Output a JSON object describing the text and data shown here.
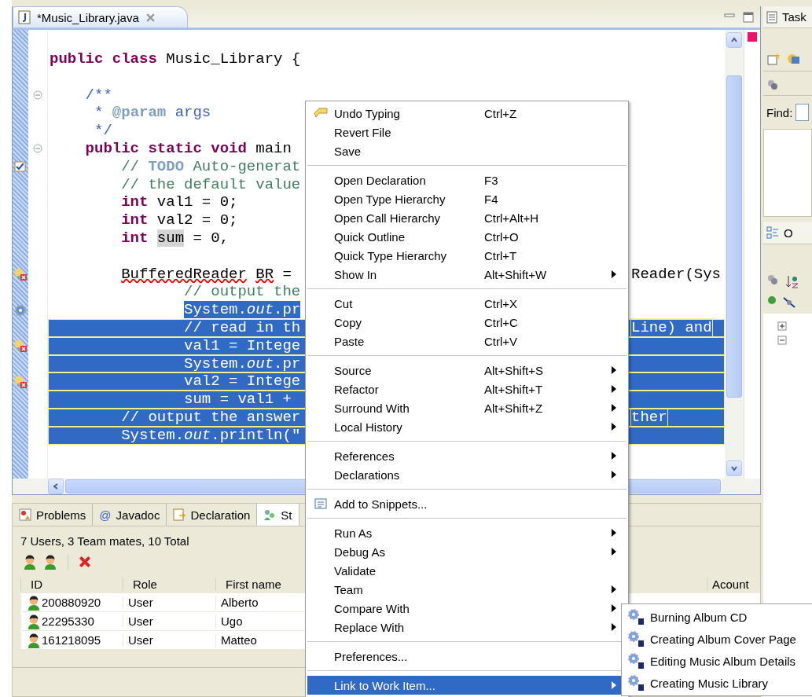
{
  "editor": {
    "tab": {
      "label": "*Music_Library.java",
      "selected": true
    },
    "lines": [
      {
        "segments": [
          {
            "t": "public class",
            "kind": "kw",
            "selected": false
          },
          {
            "t": " Music_Library {",
            "kind": "plain",
            "selected": false
          }
        ],
        "selected": false
      },
      {
        "selected": false
      },
      {
        "segments": [
          {
            "t": "    /**",
            "kind": "doc",
            "selected": false
          }
        ],
        "selected": false
      },
      {
        "segments": [
          {
            "t": "     *",
            "kind": "doc",
            "selected": false
          },
          {
            "t": " @param",
            "kind": "tag",
            "selected": false
          },
          {
            "t": " args",
            "kind": "doc",
            "selected": false
          }
        ],
        "selected": false
      },
      {
        "segments": [
          {
            "t": "     */",
            "kind": "doc",
            "selected": false
          }
        ],
        "selected": false
      },
      {
        "segments": [
          {
            "t": "    public static void",
            "kind": "kw",
            "selected": false
          },
          {
            "t": " main",
            "kind": "plain",
            "selected": false
          }
        ],
        "selected": false
      },
      {
        "segments": [
          {
            "t": "        //",
            "kind": "comment",
            "selected": false
          },
          {
            "t": " TODO",
            "kind": "tag",
            "selected": false
          },
          {
            "t": " Auto-generat",
            "kind": "comment",
            "selected": false
          }
        ],
        "selected": false
      },
      {
        "segments": [
          {
            "t": "        // the default value",
            "kind": "comment",
            "selected": false
          }
        ],
        "selected": false
      },
      {
        "segments": [
          {
            "t": "        int",
            "kind": "kw",
            "selected": false
          },
          {
            "t": " val1 = 0;",
            "kind": "plain",
            "selected": false
          }
        ],
        "selected": false
      },
      {
        "segments": [
          {
            "t": "        int",
            "kind": "kw",
            "selected": false
          },
          {
            "t": " val2 = 0;",
            "kind": "plain",
            "selected": false
          }
        ],
        "selected": false
      },
      {
        "segments": [
          {
            "t": "        int",
            "kind": "kw",
            "selected": false
          },
          {
            "t": " sum",
            "kind": "occurrence",
            "selected": false
          },
          {
            "t": " = 0,",
            "kind": "plain",
            "selected": false
          }
        ],
        "selected": false
      },
      {
        "selected": false
      },
      {
        "segments": [
          {
            "t": "        BufferedReader",
            "kind": "error",
            "selected": false
          },
          {
            "t": " BR",
            "kind": "error",
            "selected": false
          },
          {
            "t": " =",
            "kind": "plain",
            "selected": false
          }
        ],
        "right": "Reader(Sys",
        "selected": false
      },
      {
        "segments": [
          {
            "t": "               // output the",
            "kind": "comment",
            "selected": false
          }
        ],
        "selected": false
      },
      {
        "segments": [
          {
            "t": "               System.",
            "kind": "plain",
            "selected": true
          },
          {
            "t": "out",
            "kind": "italic",
            "selected": true
          },
          {
            "t": ".pr",
            "kind": "plain",
            "selected": true
          }
        ],
        "selected": false
      },
      {
        "segments": [
          {
            "t": "               // read in th",
            "kind": "plain",
            "selected": true
          }
        ],
        "right": "Line) and",
        "selected": true
      },
      {
        "segments": [
          {
            "t": "               val1 = Intege",
            "kind": "plain",
            "selected": true
          }
        ],
        "selected": true
      },
      {
        "segments": [
          {
            "t": "               System.",
            "kind": "plain",
            "selected": true
          },
          {
            "t": "out",
            "kind": "italic",
            "selected": true
          },
          {
            "t": ".pr",
            "kind": "plain",
            "selected": true
          }
        ],
        "selected": true
      },
      {
        "segments": [
          {
            "t": "               val2 = Intege",
            "kind": "plain",
            "selected": true
          }
        ],
        "selected": true
      },
      {
        "segments": [
          {
            "t": "               sum = val1 +",
            "kind": "plain",
            "selected": true
          }
        ],
        "selected": true
      },
      {
        "segments": [
          {
            "t": "        // output the answer",
            "kind": "plain",
            "selected": true
          }
        ],
        "right": "ther",
        "selected": true
      },
      {
        "segments": [
          {
            "t": "        System.",
            "kind": "plain",
            "selected": true
          },
          {
            "t": "out",
            "kind": "italic",
            "selected": true
          },
          {
            "t": ".println(\"",
            "kind": "plain",
            "selected": true
          }
        ],
        "selected": true
      }
    ]
  },
  "bottom_panel": {
    "tabs": [
      {
        "label": "Problems",
        "selected": false
      },
      {
        "glyph": "@",
        "label": "Javadoc",
        "selected": false
      },
      {
        "label": "Declaration",
        "selected": false
      },
      {
        "label": "St",
        "selected": true
      }
    ],
    "summary": "7 Users, 3 Team mates, 10 Total",
    "table": {
      "columns": [
        "ID",
        "Role",
        "First name",
        "Acount"
      ],
      "rows": [
        {
          "id": "200880920",
          "role": "User",
          "first_name": "Alberto"
        },
        {
          "id": "22295330",
          "role": "User",
          "first_name": "Ugo"
        },
        {
          "id": "161218095",
          "role": "User",
          "first_name": "Matteo"
        }
      ]
    }
  },
  "right_panel": {
    "tasks_tab": "Task",
    "find_label": "Find:",
    "outline_tab": "O"
  },
  "context_menu": {
    "items": [
      {
        "kind": "item",
        "label": "Undo Typing",
        "shortcut": "Ctrl+Z",
        "submenu": false,
        "selected": false
      },
      {
        "kind": "item",
        "label": "Revert File",
        "submenu": false,
        "selected": false
      },
      {
        "kind": "item",
        "label": "Save",
        "submenu": false,
        "selected": false
      },
      {
        "kind": "separator"
      },
      {
        "kind": "item",
        "label": "Open Declaration",
        "shortcut": "F3",
        "submenu": false,
        "selected": false
      },
      {
        "kind": "item",
        "label": "Open Type Hierarchy",
        "shortcut": "F4",
        "submenu": false,
        "selected": false
      },
      {
        "kind": "item",
        "label": "Open Call Hierarchy",
        "shortcut": "Ctrl+Alt+H",
        "submenu": false,
        "selected": false
      },
      {
        "kind": "item",
        "label": "Quick Outline",
        "shortcut": "Ctrl+O",
        "submenu": false,
        "selected": false
      },
      {
        "kind": "item",
        "label": "Quick Type Hierarchy",
        "shortcut": "Ctrl+T",
        "submenu": false,
        "selected": false
      },
      {
        "kind": "item",
        "label": "Show In",
        "shortcut": "Alt+Shift+W",
        "submenu": true,
        "selected": false
      },
      {
        "kind": "separator"
      },
      {
        "kind": "item",
        "label": "Cut",
        "shortcut": "Ctrl+X",
        "submenu": false,
        "selected": false
      },
      {
        "kind": "item",
        "label": "Copy",
        "shortcut": "Ctrl+C",
        "submenu": false,
        "selected": false
      },
      {
        "kind": "item",
        "label": "Paste",
        "shortcut": "Ctrl+V",
        "submenu": false,
        "selected": false
      },
      {
        "kind": "separator"
      },
      {
        "kind": "item",
        "label": "Source",
        "shortcut": "Alt+Shift+S",
        "submenu": true,
        "selected": false
      },
      {
        "kind": "item",
        "label": "Refactor",
        "shortcut": "Alt+Shift+T",
        "submenu": true,
        "selected": false
      },
      {
        "kind": "item",
        "label": "Surround With",
        "shortcut": "Alt+Shift+Z",
        "submenu": true,
        "selected": false
      },
      {
        "kind": "item",
        "label": "Local History",
        "submenu": true,
        "selected": false
      },
      {
        "kind": "separator"
      },
      {
        "kind": "item",
        "label": "References",
        "submenu": true,
        "selected": false
      },
      {
        "kind": "item",
        "label": "Declarations",
        "submenu": true,
        "selected": false
      },
      {
        "kind": "separator"
      },
      {
        "kind": "item",
        "label": "Add to Snippets...",
        "submenu": false,
        "selected": false
      },
      {
        "kind": "separator"
      },
      {
        "kind": "item",
        "label": "Run As",
        "submenu": true,
        "selected": false
      },
      {
        "kind": "item",
        "label": "Debug As",
        "submenu": true,
        "selected": false
      },
      {
        "kind": "item",
        "label": "Validate",
        "submenu": false,
        "selected": false
      },
      {
        "kind": "item",
        "label": "Team",
        "submenu": true,
        "selected": false
      },
      {
        "kind": "item",
        "label": "Compare With",
        "submenu": true,
        "selected": false
      },
      {
        "kind": "item",
        "label": "Replace With",
        "submenu": true,
        "selected": false
      },
      {
        "kind": "separator"
      },
      {
        "kind": "item",
        "label": "Preferences...",
        "submenu": false,
        "selected": false
      },
      {
        "kind": "separator"
      },
      {
        "kind": "item",
        "label": "Link to Work Item...",
        "submenu": true,
        "selected": true
      }
    ]
  },
  "submenu": {
    "items": [
      {
        "label": "Burning Album CD"
      },
      {
        "label": "Creating Album Cover Page"
      },
      {
        "label": "Editing Music Album Details"
      },
      {
        "label": "Creating Music Library"
      }
    ]
  }
}
